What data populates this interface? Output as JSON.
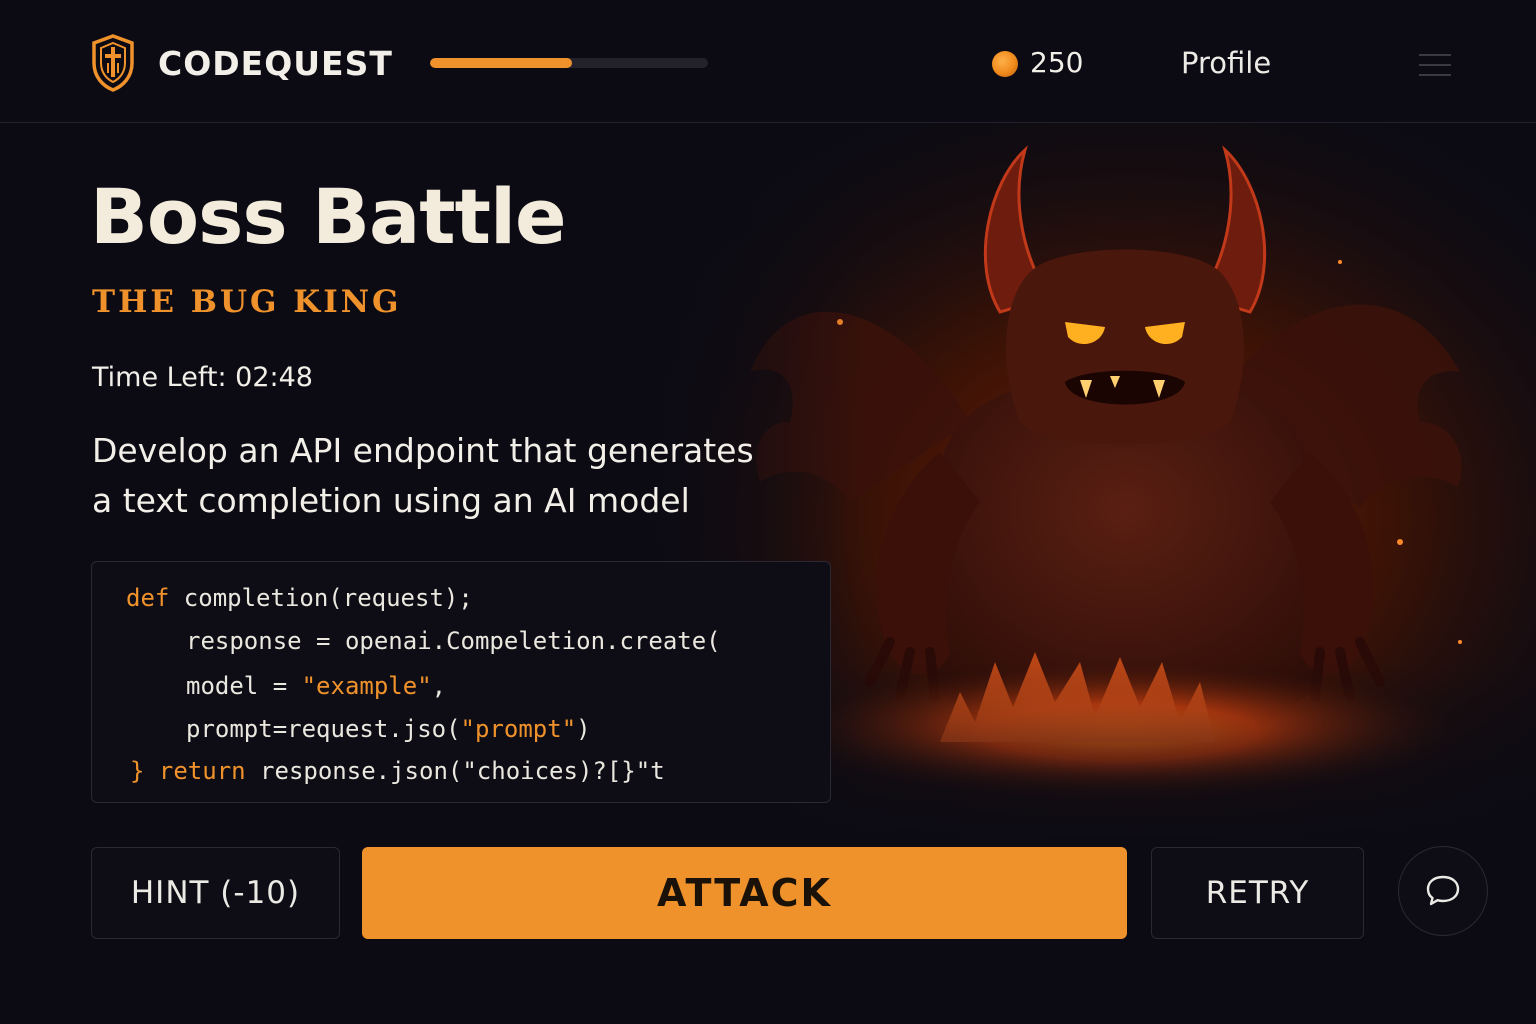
{
  "header": {
    "brand": "CODEQUEST",
    "progress_fraction": 0.51,
    "coins": "250",
    "profile_label": "Profile"
  },
  "battle": {
    "title": "Boss Battle",
    "boss_name": "THE BUG KING",
    "timer": "Time Left: 02:48",
    "task_lines": [
      "Develop an API endpoint that generates",
      "a text completion using an AI model"
    ]
  },
  "code": {
    "line1_kw": "def",
    "line1_rest": " completion(request);",
    "line2": "response = openai.Compeletion.create(",
    "line3_a": "model = ",
    "line3_str": "\"example\"",
    "line3_b": ",",
    "line4_a": "prompt=request.jso(",
    "line4_str": "\"prompt\"",
    "line4_b": ")",
    "line5_brace": "}",
    "line5_kw": "return",
    "line5_rest": " response.json(\"choices)?[}\"t"
  },
  "buttons": {
    "hint": "HINT (-10)",
    "attack": "ATTACK",
    "retry": "RETRY"
  },
  "icons": {
    "logo": "shield-sword-icon",
    "coin": "coin-icon",
    "menu": "hamburger-menu-icon",
    "chat": "chat-bubble-icon"
  },
  "colors": {
    "accent": "#f0922b",
    "background": "#0c0b13",
    "panel": "#0e0d15"
  }
}
